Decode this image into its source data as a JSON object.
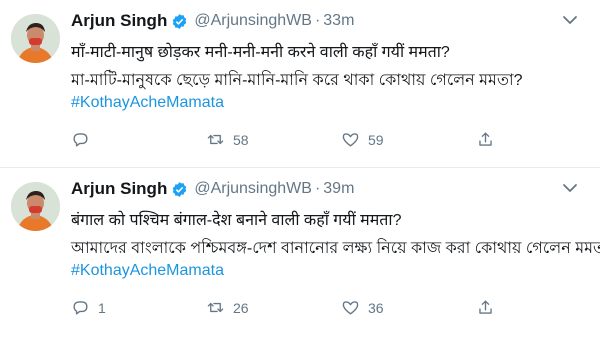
{
  "tweets": [
    {
      "name": "Arjun Singh",
      "handle": "@ArjunsinghWB",
      "separator": "·",
      "time": "33m",
      "line1": "माँ-माटी-मानुष छोड़कर मनी-मनी-मनी करने वाली कहाँ गयीं ममता?",
      "line2": "মা-মাটি-মানুষকে ছেড়ে মানি-মানি-মানি করে থাকা কোথায় গেলেন মমতা?",
      "hashtag": "#KothayAcheMamata",
      "reply_count": "",
      "retweet_count": "58",
      "like_count": "59"
    },
    {
      "name": "Arjun Singh",
      "handle": "@ArjunsinghWB",
      "separator": "·",
      "time": "39m",
      "line1": "बंगाल को पश्चिम बंगाल-देश बनाने वाली कहाँ गयीं ममता?",
      "line2": "আমাদের বাংলাকে পশ্চিমবঙ্গ-দেশ বানানোর লক্ষ্য নিয়ে কাজ করা কোথায় গেলেন মমতা?",
      "hashtag": "#KothayAcheMamata",
      "reply_count": "1",
      "retweet_count": "26",
      "like_count": "36"
    }
  ],
  "icons": {
    "verified": "verified-badge-icon",
    "caret": "chevron-down-icon",
    "reply": "reply-icon",
    "retweet": "retweet-icon",
    "like": "heart-icon",
    "share": "share-icon"
  },
  "colors": {
    "text": "#14171a",
    "muted": "#657786",
    "link": "#1b95e0",
    "verified": "#1da1f2",
    "divider": "#e6ecf0"
  }
}
